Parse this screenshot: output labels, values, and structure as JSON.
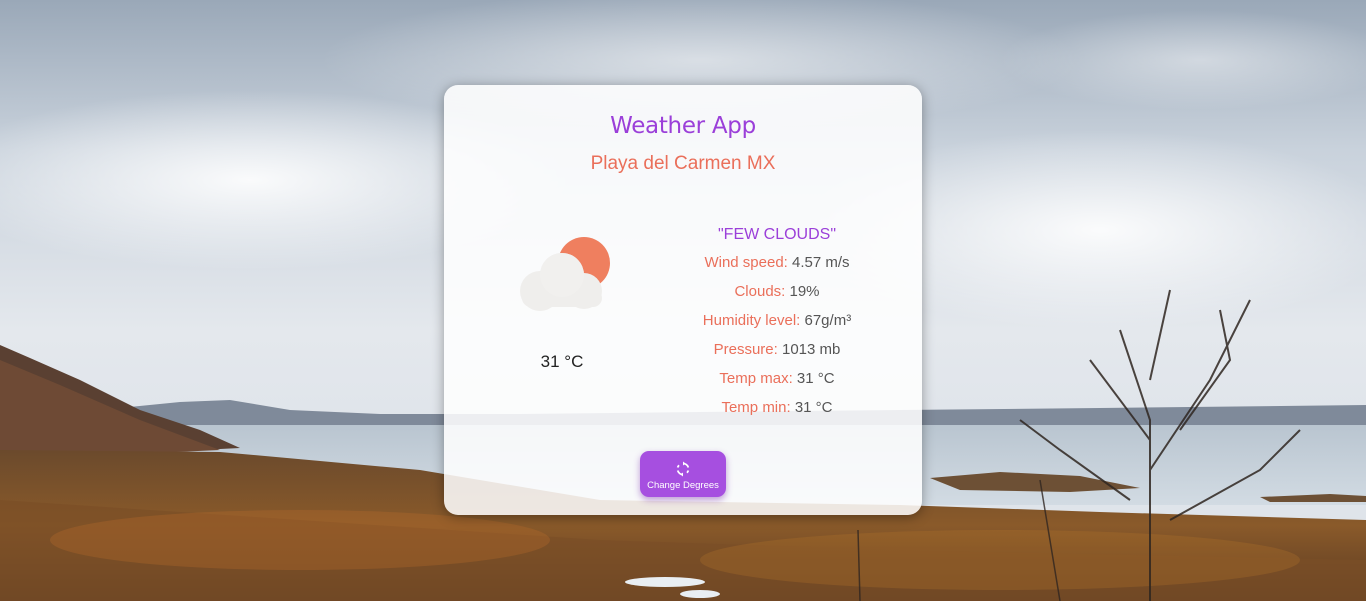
{
  "app": {
    "title": "Weather App",
    "location": "Playa del Carmen MX"
  },
  "current": {
    "icon": "few-clouds-icon",
    "temperature": "31 °C",
    "description": "\"FEW CLOUDS\""
  },
  "details": [
    {
      "label": "Wind speed:",
      "value": "4.57 m/s"
    },
    {
      "label": "Clouds:",
      "value": "19%"
    },
    {
      "label": "Humidity level:",
      "value": "67g/m³"
    },
    {
      "label": "Pressure:",
      "value": "1013 mb"
    },
    {
      "label": "Temp max:",
      "value": "31 °C"
    },
    {
      "label": "Temp min:",
      "value": "31 °C"
    }
  ],
  "button": {
    "icon": "sync-icon",
    "label": "Change Degrees"
  },
  "colors": {
    "accent_purple": "#9b3fd9",
    "accent_coral": "#ea6f5a",
    "button_bg": "#a64fe0"
  }
}
